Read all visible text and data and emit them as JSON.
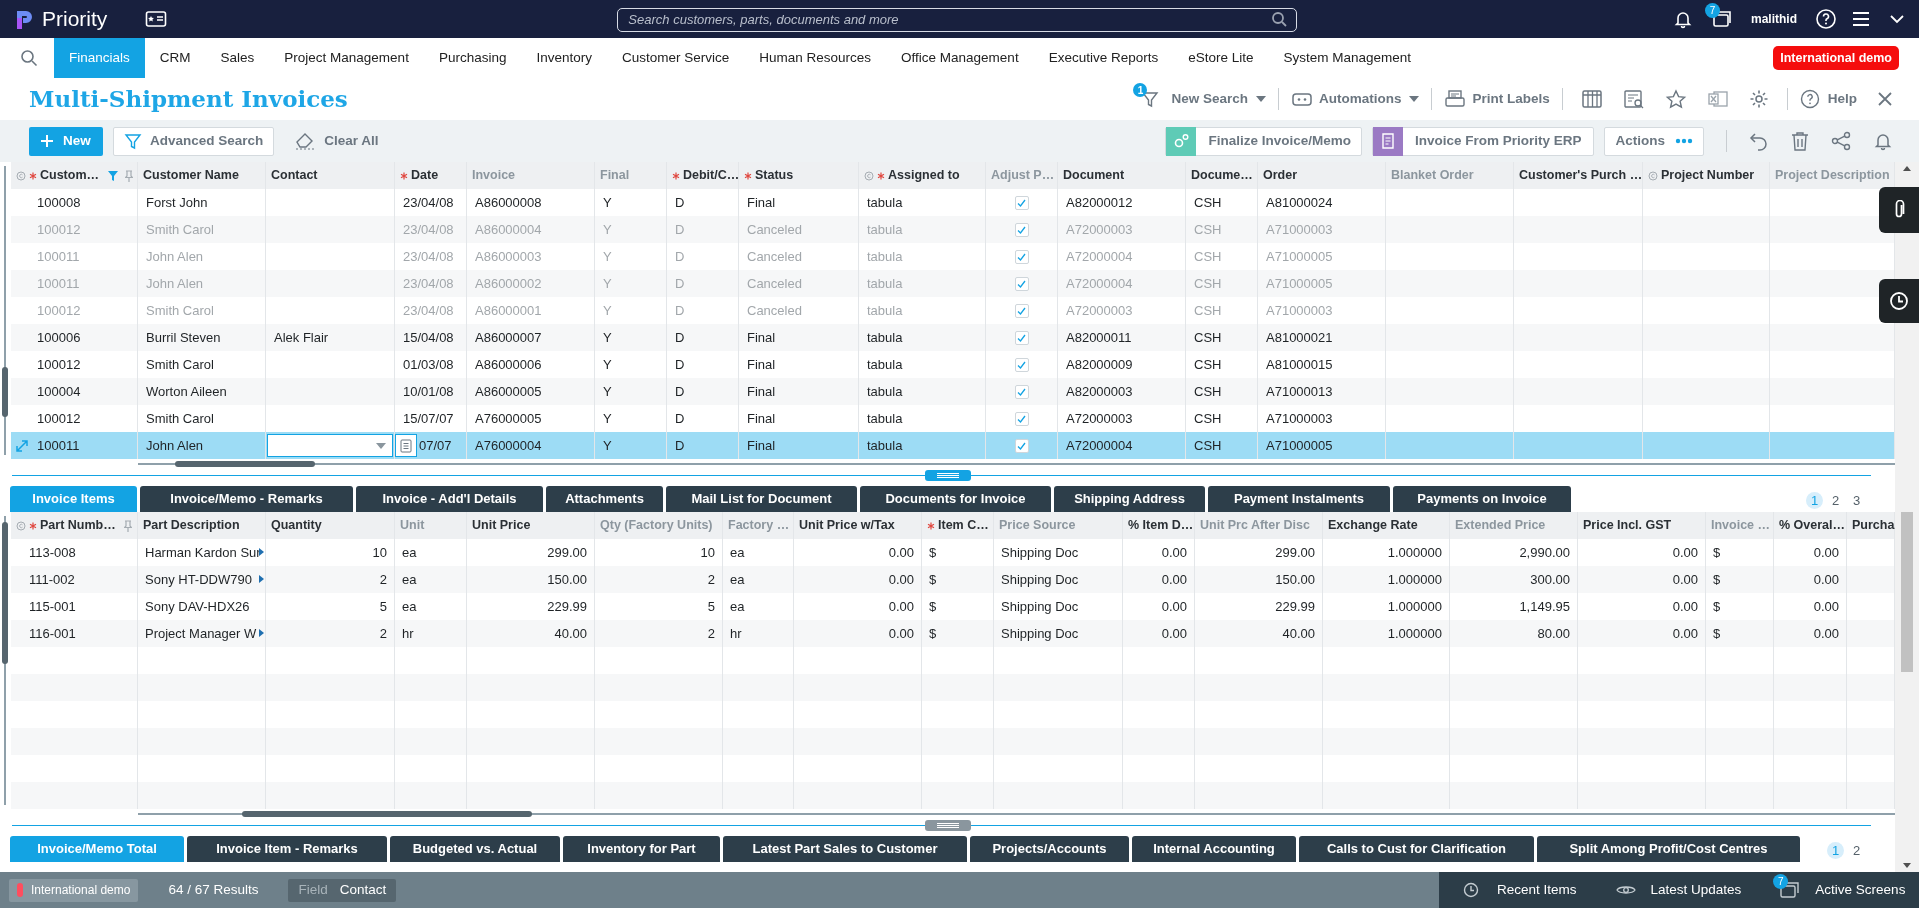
{
  "top_bar": {
    "app_name": "Priority",
    "search": {
      "placeholder": "Search customers, parts, documents and more"
    },
    "screens_badge": "7",
    "user": "malithid"
  },
  "menu": {
    "items": [
      {
        "label": "Financials",
        "selected": true
      },
      {
        "label": "CRM",
        "selected": false
      },
      {
        "label": "Sales",
        "selected": false
      },
      {
        "label": "Project Management",
        "selected": false
      },
      {
        "label": "Purchasing",
        "selected": false
      },
      {
        "label": "Inventory",
        "selected": false
      },
      {
        "label": "Customer Service",
        "selected": false
      },
      {
        "label": "Human Resources",
        "selected": false
      },
      {
        "label": "Office Management",
        "selected": false
      },
      {
        "label": "Executive Reports",
        "selected": false
      },
      {
        "label": "eStore Lite",
        "selected": false
      },
      {
        "label": "System Management",
        "selected": false
      }
    ],
    "environment_badge": "International demo"
  },
  "title_bar": {
    "title": "Multi-Shipment Invoices",
    "new_search": {
      "label": "New Search",
      "badge": "1"
    },
    "automations": {
      "label": "Automations"
    },
    "print_labels": {
      "label": "Print Labels"
    },
    "help": {
      "label": "Help"
    }
  },
  "toolbar": {
    "new_button": "New",
    "advanced_search": "Advanced Search",
    "clear_all": "Clear All",
    "finalize": "Finalize Invoice/Memo",
    "invoice_from_erp": "Invoice From Priority ERP",
    "actions": "Actions"
  },
  "invoices_table": {
    "columns": [
      {
        "label": "Custom…",
        "required": true,
        "readonly": false,
        "lookup": true,
        "filtered": true
      },
      {
        "label": "Customer Name",
        "required": false,
        "readonly": false,
        "lookup": false,
        "filtered": false
      },
      {
        "label": "Contact",
        "required": false,
        "readonly": false,
        "lookup": false,
        "filtered": false
      },
      {
        "label": "Date",
        "required": true,
        "readonly": false,
        "lookup": false,
        "filtered": false
      },
      {
        "label": "Invoice",
        "required": false,
        "readonly": true,
        "lookup": false,
        "filtered": false
      },
      {
        "label": "Final",
        "required": false,
        "readonly": true,
        "lookup": false,
        "filtered": false
      },
      {
        "label": "Debit/C…",
        "required": true,
        "readonly": false,
        "lookup": false,
        "filtered": false
      },
      {
        "label": "Status",
        "required": true,
        "readonly": false,
        "lookup": false,
        "filtered": false
      },
      {
        "label": "Assigned to",
        "required": true,
        "readonly": false,
        "lookup": true,
        "filtered": false
      },
      {
        "label": "Adjust P…",
        "required": false,
        "readonly": true,
        "lookup": false,
        "filtered": false
      },
      {
        "label": "Document",
        "required": false,
        "readonly": false,
        "lookup": false,
        "filtered": false
      },
      {
        "label": "Docume…",
        "required": false,
        "readonly": false,
        "lookup": false,
        "filtered": false
      },
      {
        "label": "Order",
        "required": false,
        "readonly": false,
        "lookup": false,
        "filtered": false
      },
      {
        "label": "Blanket Order",
        "required": false,
        "readonly": true,
        "lookup": false,
        "filtered": false
      },
      {
        "label": "Customer's Purch …",
        "required": false,
        "readonly": false,
        "lookup": false,
        "filtered": false
      },
      {
        "label": "Project Number",
        "required": false,
        "readonly": false,
        "lookup": true,
        "filtered": false
      },
      {
        "label": "Project Description",
        "required": false,
        "readonly": true,
        "lookup": false,
        "filtered": false
      }
    ],
    "rows": [
      {
        "customer": "100008",
        "customer_name": "Forst John",
        "date": "23/04/08",
        "invoice": "A86000008",
        "final": "Y",
        "debit_credit": "D",
        "status": "Final",
        "assigned_to": "tabula",
        "adjust": true,
        "document": "A82000012",
        "document_type": "CSH",
        "order": "A81000024",
        "dimmed": false,
        "selected": false
      },
      {
        "customer": "100012",
        "customer_name": "Smith Carol",
        "date": "23/04/08",
        "invoice": "A86000004",
        "final": "Y",
        "debit_credit": "D",
        "status": "Canceled",
        "assigned_to": "tabula",
        "adjust": true,
        "document": "A72000003",
        "document_type": "CSH",
        "order": "A71000003",
        "dimmed": true,
        "selected": false
      },
      {
        "customer": "100011",
        "customer_name": "John Alen",
        "date": "23/04/08",
        "invoice": "A86000003",
        "final": "Y",
        "debit_credit": "D",
        "status": "Canceled",
        "assigned_to": "tabula",
        "adjust": true,
        "document": "A72000004",
        "document_type": "CSH",
        "order": "A71000005",
        "dimmed": true,
        "selected": false
      },
      {
        "customer": "100011",
        "customer_name": "John Alen",
        "date": "23/04/08",
        "invoice": "A86000002",
        "final": "Y",
        "debit_credit": "D",
        "status": "Canceled",
        "assigned_to": "tabula",
        "adjust": true,
        "document": "A72000004",
        "document_type": "CSH",
        "order": "A71000005",
        "dimmed": true,
        "selected": false
      },
      {
        "customer": "100012",
        "customer_name": "Smith Carol",
        "date": "23/04/08",
        "invoice": "A86000001",
        "final": "Y",
        "debit_credit": "D",
        "status": "Canceled",
        "assigned_to": "tabula",
        "adjust": true,
        "document": "A72000003",
        "document_type": "CSH",
        "order": "A71000003",
        "dimmed": true,
        "selected": false
      },
      {
        "customer": "100006",
        "customer_name": "Burril Steven",
        "contact": "Alek Flair",
        "date": "15/04/08",
        "invoice": "A86000007",
        "final": "Y",
        "debit_credit": "D",
        "status": "Final",
        "assigned_to": "tabula",
        "adjust": true,
        "document": "A82000011",
        "document_type": "CSH",
        "order": "A81000021",
        "dimmed": false,
        "selected": false
      },
      {
        "customer": "100012",
        "customer_name": "Smith Carol",
        "date": "01/03/08",
        "invoice": "A86000006",
        "final": "Y",
        "debit_credit": "D",
        "status": "Final",
        "assigned_to": "tabula",
        "adjust": true,
        "document": "A82000009",
        "document_type": "CSH",
        "order": "A81000015",
        "dimmed": false,
        "selected": false
      },
      {
        "customer": "100004",
        "customer_name": "Worton Aileen",
        "date": "10/01/08",
        "invoice": "A86000005",
        "final": "Y",
        "debit_credit": "D",
        "status": "Final",
        "assigned_to": "tabula",
        "adjust": true,
        "document": "A82000003",
        "document_type": "CSH",
        "order": "A71000013",
        "dimmed": false,
        "selected": false
      },
      {
        "customer": "100012",
        "customer_name": "Smith Carol",
        "date": "15/07/07",
        "invoice": "A76000005",
        "final": "Y",
        "debit_credit": "D",
        "status": "Final",
        "assigned_to": "tabula",
        "adjust": true,
        "document": "A72000003",
        "document_type": "CSH",
        "order": "A71000003",
        "dimmed": false,
        "selected": false
      },
      {
        "customer": "100011",
        "customer_name": "John Alen",
        "date": "07/07",
        "invoice": "A76000004",
        "final": "Y",
        "debit_credit": "D",
        "status": "Final",
        "assigned_to": "tabula",
        "adjust": true,
        "document": "A72000004",
        "document_type": "CSH",
        "order": "A71000005",
        "dimmed": false,
        "selected": true
      }
    ]
  },
  "sub_tabs": {
    "tabs": [
      {
        "label": "Invoice Items",
        "selected": true
      },
      {
        "label": "Invoice/Memo - Remarks",
        "selected": false
      },
      {
        "label": "Invoice - Add'l Details",
        "selected": false
      },
      {
        "label": "Attachments",
        "selected": false
      },
      {
        "label": "Mail List for Document",
        "selected": false
      },
      {
        "label": "Documents for Invoice",
        "selected": false
      },
      {
        "label": "Shipping Address",
        "selected": false
      },
      {
        "label": "Payment Instalments",
        "selected": false
      },
      {
        "label": "Payments on Invoice",
        "selected": false
      }
    ],
    "pages": [
      {
        "label": "1",
        "selected": true
      },
      {
        "label": "2",
        "selected": false
      },
      {
        "label": "3",
        "selected": false
      }
    ]
  },
  "items_table": {
    "columns": [
      {
        "label": "Part Numb…",
        "required": true,
        "readonly": false,
        "lookup": true,
        "kind": "text"
      },
      {
        "label": "Part Description",
        "required": false,
        "readonly": false,
        "lookup": false,
        "kind": "text"
      },
      {
        "label": "Quantity",
        "required": false,
        "readonly": false,
        "lookup": false,
        "kind": "number"
      },
      {
        "label": "Unit",
        "required": false,
        "readonly": true,
        "lookup": false,
        "kind": "text"
      },
      {
        "label": "Unit Price",
        "required": false,
        "readonly": false,
        "lookup": false,
        "kind": "number"
      },
      {
        "label": "Qty (Factory Units)",
        "required": false,
        "readonly": true,
        "lookup": false,
        "kind": "number"
      },
      {
        "label": "Factory …",
        "required": false,
        "readonly": true,
        "lookup": false,
        "kind": "text"
      },
      {
        "label": "Unit Price w/Tax",
        "required": false,
        "readonly": false,
        "lookup": false,
        "kind": "number"
      },
      {
        "label": "Item C…",
        "required": true,
        "readonly": false,
        "lookup": false,
        "kind": "text"
      },
      {
        "label": "Price Source",
        "required": false,
        "readonly": true,
        "lookup": false,
        "kind": "text"
      },
      {
        "label": "% Item D…",
        "required": false,
        "readonly": false,
        "lookup": false,
        "kind": "number"
      },
      {
        "label": "Unit Prc After Disc",
        "required": false,
        "readonly": true,
        "lookup": false,
        "kind": "number"
      },
      {
        "label": "Exchange Rate",
        "required": false,
        "readonly": false,
        "lookup": false,
        "kind": "number"
      },
      {
        "label": "Extended Price",
        "required": false,
        "readonly": true,
        "lookup": false,
        "kind": "number"
      },
      {
        "label": "Price Incl. GST",
        "required": false,
        "readonly": false,
        "lookup": false,
        "kind": "number"
      },
      {
        "label": "Invoice …",
        "required": false,
        "readonly": true,
        "lookup": false,
        "kind": "text"
      },
      {
        "label": "% Overal…",
        "required": false,
        "readonly": false,
        "lookup": false,
        "kind": "number"
      },
      {
        "label": "Purcha",
        "required": false,
        "readonly": false,
        "lookup": false,
        "kind": "number"
      }
    ],
    "rows": [
      {
        "cells": [
          "113-008",
          "Harman Kardon Sur",
          "10",
          "ea",
          "299.00",
          "10",
          "ea",
          "0.00",
          "$",
          "Shipping Doc",
          "0.00",
          "299.00",
          "1.000000",
          "2,990.00",
          "0.00",
          "$",
          "0.00"
        ],
        "overflow": true
      },
      {
        "cells": [
          "111-002",
          "Sony HT-DDW790",
          "2",
          "ea",
          "150.00",
          "2",
          "ea",
          "0.00",
          "$",
          "Shipping Doc",
          "0.00",
          "150.00",
          "1.000000",
          "300.00",
          "0.00",
          "$",
          "0.00"
        ],
        "overflow": true
      },
      {
        "cells": [
          "115-001",
          "Sony DAV-HDX26",
          "5",
          "ea",
          "229.99",
          "5",
          "ea",
          "0.00",
          "$",
          "Shipping Doc",
          "0.00",
          "229.99",
          "1.000000",
          "1,149.95",
          "0.00",
          "$",
          "0.00"
        ],
        "overflow": false
      },
      {
        "cells": [
          "116-001",
          "Project Manager W",
          "2",
          "hr",
          "40.00",
          "2",
          "hr",
          "0.00",
          "$",
          "Shipping Doc",
          "0.00",
          "40.00",
          "1.000000",
          "80.00",
          "0.00",
          "$",
          "0.00"
        ],
        "overflow": true
      }
    ]
  },
  "bottom_tabs": {
    "tabs": [
      {
        "label": "Invoice/Memo Total",
        "selected": true
      },
      {
        "label": "Invoice Item - Remarks",
        "selected": false
      },
      {
        "label": "Budgeted vs. Actual",
        "selected": false
      },
      {
        "label": "Inventory for Part",
        "selected": false
      },
      {
        "label": "Latest Part Sales to Customer",
        "selected": false
      },
      {
        "label": "Projects/Accounts",
        "selected": false
      },
      {
        "label": "Internal Accounting",
        "selected": false
      },
      {
        "label": "Calls to Cust for Clarification",
        "selected": false
      },
      {
        "label": "Split Among Profit/Cost Centres",
        "selected": false
      }
    ],
    "pages": [
      {
        "label": "1",
        "selected": true
      },
      {
        "label": "2",
        "selected": false
      }
    ]
  },
  "status_bar": {
    "environment": "International demo",
    "results": "64 / 67 Results",
    "field_label": "Field",
    "field_value": "Contact",
    "recent_items": "Recent Items",
    "latest_updates": "Latest Updates",
    "active_screens": "Active Screens",
    "active_screens_badge": "7"
  }
}
